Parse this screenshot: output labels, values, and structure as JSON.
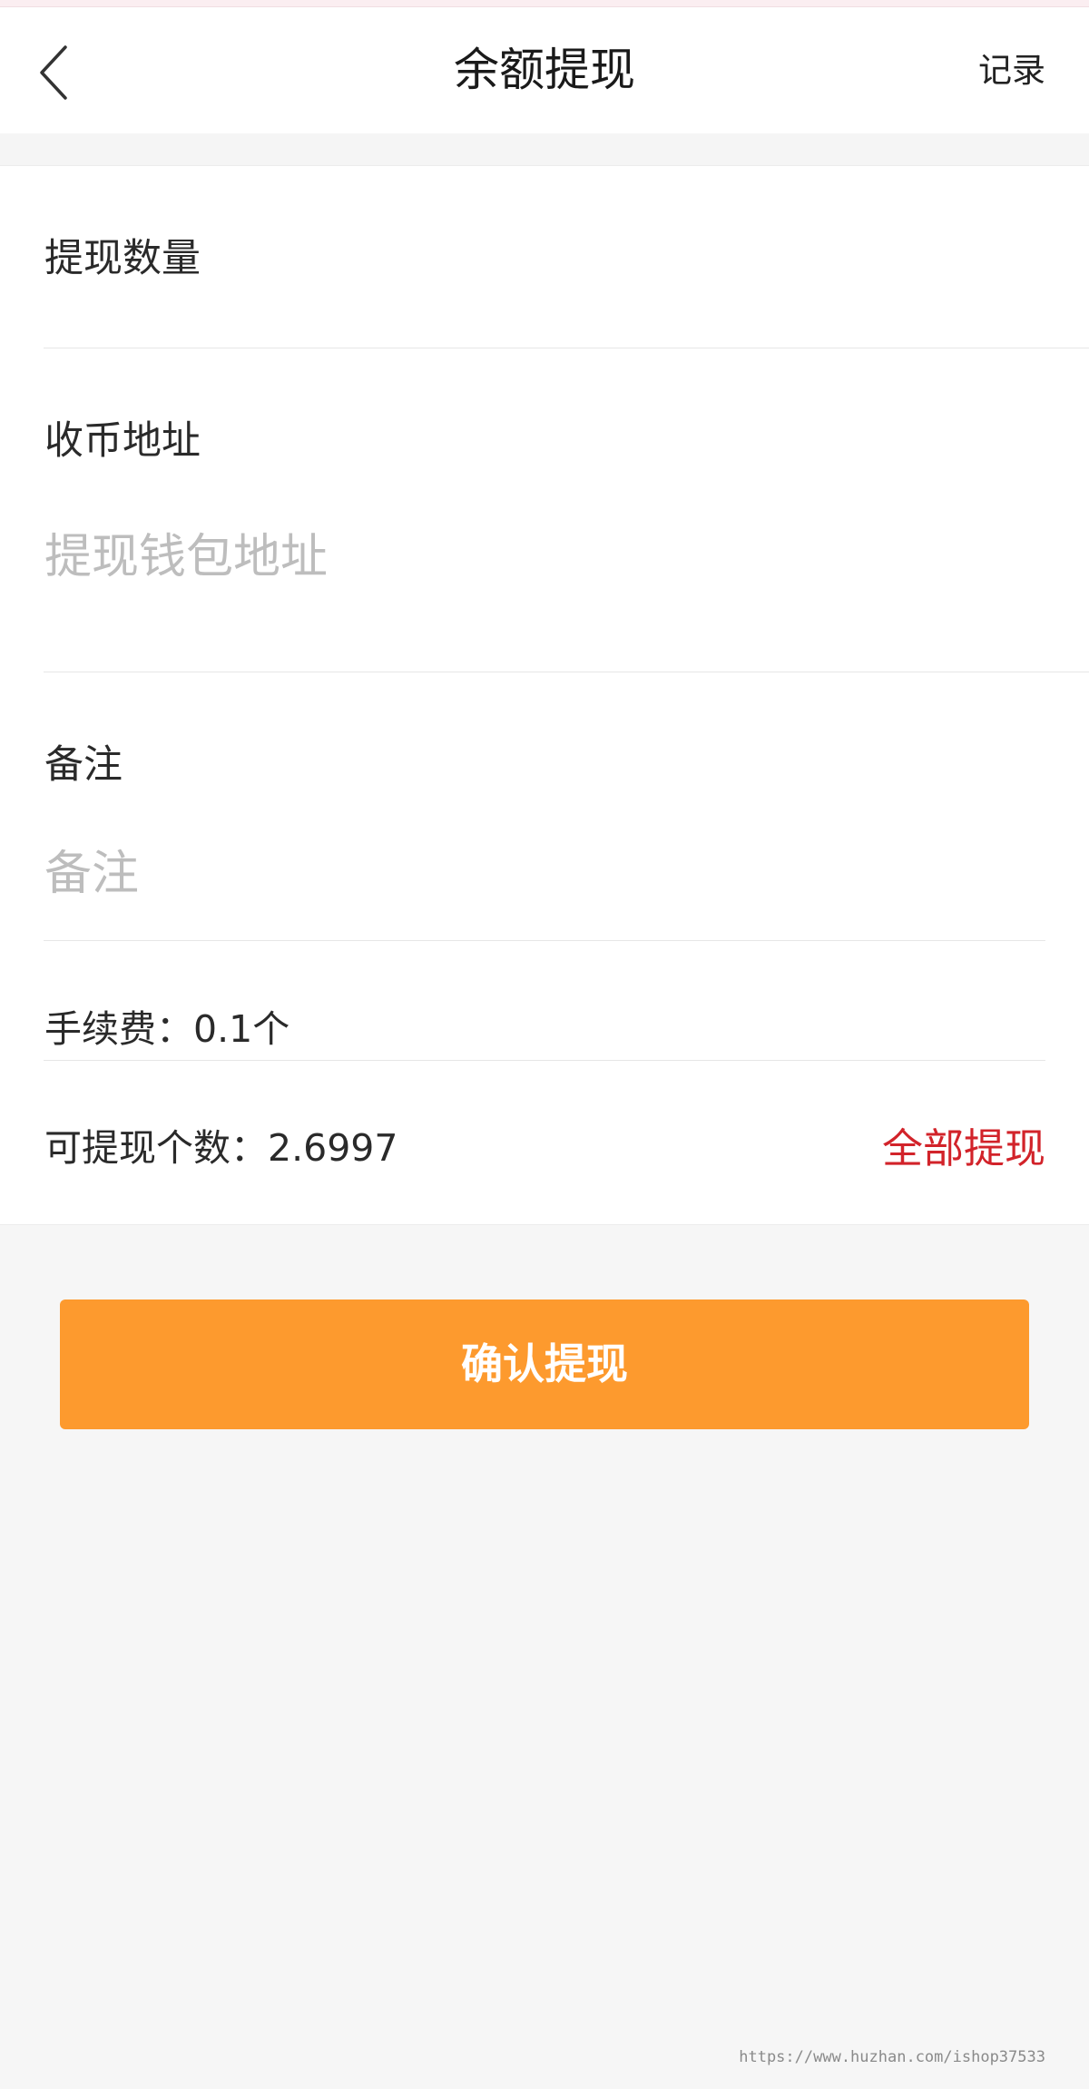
{
  "header": {
    "title": "余额提现",
    "record_label": "记录",
    "back_icon": "chevron-left-icon"
  },
  "form": {
    "amount_label": "提现数量",
    "amount_value": "",
    "address_label": "收币地址",
    "address_placeholder": "提现钱包地址",
    "remark_label": "备注",
    "remark_placeholder": "备注",
    "fee_text": "手续费：0.1个",
    "available_text": "可提现个数：2.6997",
    "withdraw_all_label": "全部提现"
  },
  "actions": {
    "confirm_label": "确认提现"
  },
  "watermark": "https://www.huzhan.com/ishop37533",
  "colors": {
    "accent": "#fd9a2e",
    "link_red": "#d2232a",
    "placeholder": "#b9b9b9"
  }
}
